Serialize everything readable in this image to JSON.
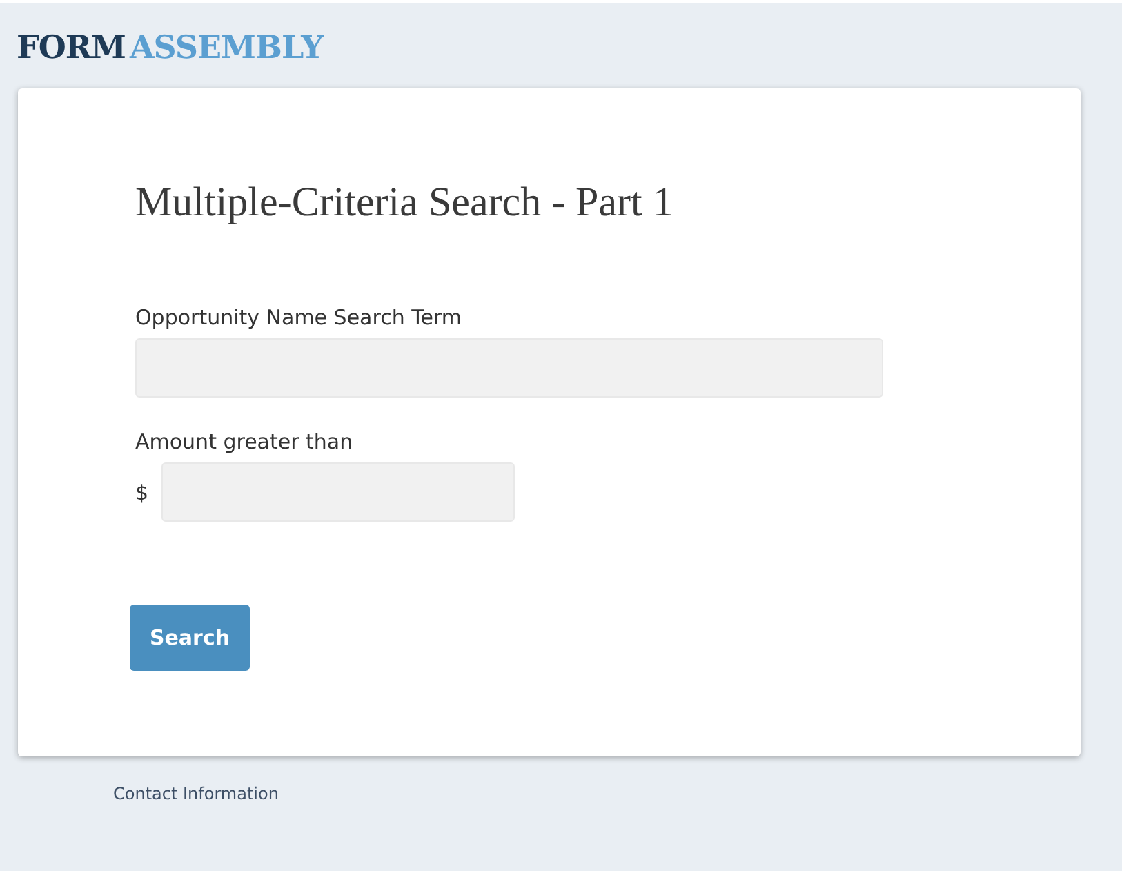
{
  "logo": {
    "part_1": "FORM",
    "part_2": "ASSEMBLY"
  },
  "form": {
    "title": "Multiple-Criteria Search - Part 1",
    "fields": [
      {
        "kind": "text",
        "label": "Opportunity Name Search Term"
      },
      {
        "kind": "currency",
        "label": "Amount greater than",
        "prefix": "$"
      }
    ],
    "submit": "Search"
  },
  "footer": {
    "link": "Contact Information"
  }
}
